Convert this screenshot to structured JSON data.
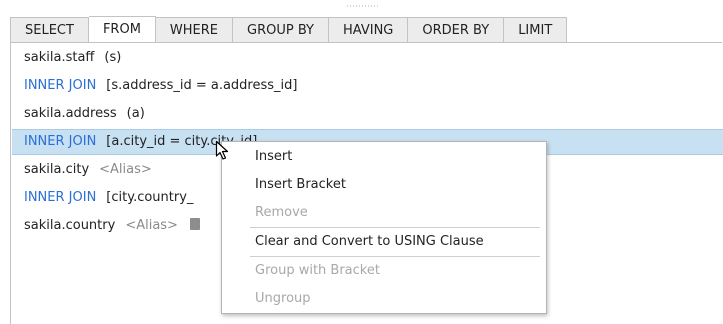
{
  "tabs": [
    {
      "label": "SELECT",
      "active": false
    },
    {
      "label": "FROM",
      "active": true
    },
    {
      "label": "WHERE",
      "active": false
    },
    {
      "label": "GROUP BY",
      "active": false
    },
    {
      "label": "HAVING",
      "active": false
    },
    {
      "label": "ORDER BY",
      "active": false
    },
    {
      "label": "LIMIT",
      "active": false
    }
  ],
  "rows": {
    "r0": {
      "table": "sakila.staff",
      "alias": "(s)"
    },
    "r1": {
      "join": "INNER JOIN",
      "condition": "[s.address_id = a.address_id]"
    },
    "r2": {
      "table": "sakila.address",
      "alias": "(a)"
    },
    "r3": {
      "join": "INNER JOIN",
      "condition": "[a.city_id = city.city_id]"
    },
    "r4": {
      "table": "sakila.city",
      "alias": "<Alias>"
    },
    "r5": {
      "join": "INNER JOIN",
      "condition": "[city.country_"
    },
    "r6": {
      "table": "sakila.country",
      "alias": "<Alias>"
    }
  },
  "context_menu": {
    "insert": "Insert",
    "insert_bracket": "Insert Bracket",
    "remove": "Remove",
    "clear_convert": "Clear and Convert to USING Clause",
    "group_bracket": "Group with Bracket",
    "ungroup": "Ungroup"
  },
  "colors": {
    "keyword": "#2b6fd6",
    "selection": "#c7e0f2",
    "placeholder": "#8a8a8a"
  }
}
